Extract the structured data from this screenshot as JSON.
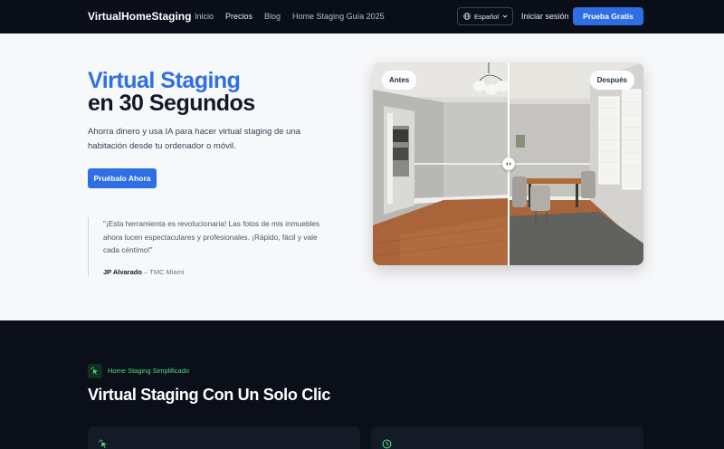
{
  "nav": {
    "logo": "VirtualHomeStaging",
    "links": [
      {
        "label": "Inicio"
      },
      {
        "label": "Precios"
      },
      {
        "label": "Blog"
      },
      {
        "label": "Home Staging Guía 2025"
      }
    ],
    "language": "Español",
    "login": "Iniciar sesión",
    "cta": "Prueba Gratis"
  },
  "hero": {
    "title_line1": "Virtual Staging",
    "title_line2": "en 30 Segundos",
    "description": "Ahorra dinero y usa IA para hacer virtual staging de una habitación desde tu ordenador o móvil.",
    "button": "Pruébalo Ahora",
    "quote": "\"¡Esta herramienta es revolucionaria! Las fotos de mis inmuebles ahora lucen espectaculares y profesionales. ¡Rápido, fácil y vale cada céntimo!\"",
    "quote_author": "JP Alvarado",
    "quote_company": " – TMC Miami",
    "compare": {
      "before_label": "Antes",
      "after_label": "Después"
    }
  },
  "features": {
    "tag": "Home Staging Simplificado",
    "title": "Virtual Staging Con Un Solo Clic"
  },
  "colors": {
    "accent": "#2f6fe6",
    "nav_bg": "#0a0e19",
    "hero_bg": "#f7f8fa",
    "tag_green": "#4ade80"
  }
}
